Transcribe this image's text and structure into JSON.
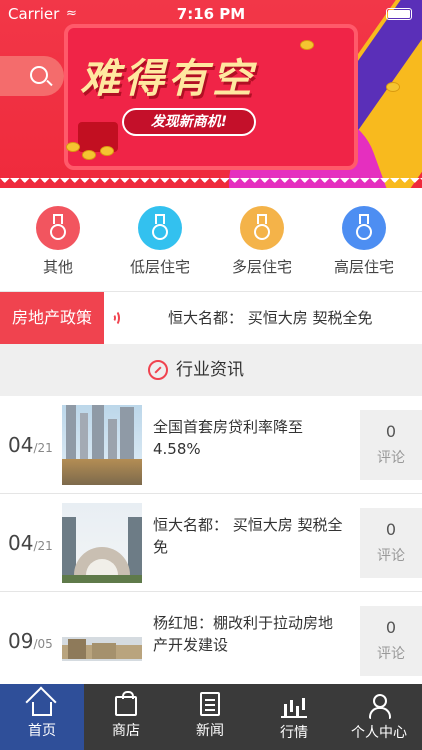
{
  "status_bar": {
    "carrier": "Carrier",
    "time": "7:16 PM"
  },
  "banner": {
    "headline": "难得有空",
    "slogan": "发现新商机!"
  },
  "categories": [
    {
      "label": "其他",
      "color": "#f2555f"
    },
    {
      "label": "低层住宅",
      "color": "#33c1ef"
    },
    {
      "label": "多层住宅",
      "color": "#f4b349"
    },
    {
      "label": "高层住宅",
      "color": "#4d8ef2"
    }
  ],
  "policy": {
    "tag": "房地产政策",
    "headline": "恒大名都： 买恒大房  契税全免"
  },
  "section": {
    "title": "行业资讯"
  },
  "news": [
    {
      "day": "04",
      "month": "/21",
      "title": "全国首套房贷利率降至4.58%",
      "comments": "0",
      "comments_label": "评论"
    },
    {
      "day": "04",
      "month": "/21",
      "title": "恒大名都： 买恒大房  契税全免",
      "comments": "0",
      "comments_label": "评论"
    },
    {
      "day": "09",
      "month": "/05",
      "title": "杨红旭：棚改利于拉动房地产开发建设",
      "comments": "0",
      "comments_label": "评论"
    }
  ],
  "tabs": [
    {
      "label": "首页",
      "icon": "home-icon",
      "active": true
    },
    {
      "label": "商店",
      "icon": "shopping-bag-icon",
      "active": false
    },
    {
      "label": "新闻",
      "icon": "news-icon",
      "active": false
    },
    {
      "label": "行情",
      "icon": "chart-icon",
      "active": false
    },
    {
      "label": "个人中心",
      "icon": "user-icon",
      "active": false
    }
  ],
  "colors": {
    "accent": "#f0434f",
    "tabbar": "#3a3a3a",
    "tab_active": "#2f4f99"
  }
}
